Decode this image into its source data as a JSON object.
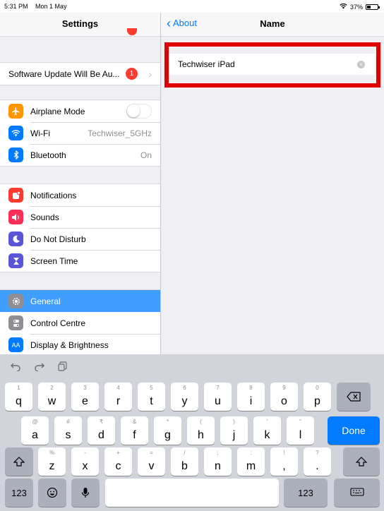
{
  "status_bar": {
    "time": "5:31 PM",
    "date": "Mon 1 May",
    "battery": "37%",
    "battery_level": 0.37
  },
  "sidebar": {
    "title": "Settings",
    "update_row": {
      "label": "Software Update Will Be Au...",
      "badge": "1"
    },
    "connectivity": [
      {
        "label": "Airplane Mode",
        "icon": "airplane-icon",
        "color": "#ff9500",
        "value": "",
        "toggle": false
      },
      {
        "label": "Wi-Fi",
        "icon": "wifi-icon",
        "color": "#007aff",
        "value": "Techwiser_5GHz"
      },
      {
        "label": "Bluetooth",
        "icon": "bluetooth-icon",
        "color": "#007aff",
        "value": "On"
      }
    ],
    "notifications": [
      {
        "label": "Notifications",
        "icon": "notifications-icon",
        "color": "#ff3b30"
      },
      {
        "label": "Sounds",
        "icon": "speaker-icon",
        "color": "#ff2d55"
      },
      {
        "label": "Do Not Disturb",
        "icon": "moon-icon",
        "color": "#5856d6"
      },
      {
        "label": "Screen Time",
        "icon": "hourglass-icon",
        "color": "#5856d6"
      }
    ],
    "general": [
      {
        "label": "General",
        "icon": "gear-icon",
        "color": "#8e8e93",
        "selected": true
      },
      {
        "label": "Control Centre",
        "icon": "switches-icon",
        "color": "#8e8e93"
      },
      {
        "label": "Display & Brightness",
        "icon": "text-size-icon",
        "color": "#007aff",
        "glyph": "AA"
      }
    ]
  },
  "detail": {
    "back_label": "About",
    "title": "Name",
    "name_value": "Techwiser iPad"
  },
  "keyboard": {
    "row1": [
      {
        "k": "q",
        "h": "1"
      },
      {
        "k": "w",
        "h": "2"
      },
      {
        "k": "e",
        "h": "3"
      },
      {
        "k": "r",
        "h": "4"
      },
      {
        "k": "t",
        "h": "5"
      },
      {
        "k": "y",
        "h": "6"
      },
      {
        "k": "u",
        "h": "7"
      },
      {
        "k": "i",
        "h": "8"
      },
      {
        "k": "o",
        "h": "9"
      },
      {
        "k": "p",
        "h": "0"
      }
    ],
    "row2": [
      {
        "k": "a",
        "h": "@"
      },
      {
        "k": "s",
        "h": "#"
      },
      {
        "k": "d",
        "h": "₹"
      },
      {
        "k": "f",
        "h": "&"
      },
      {
        "k": "g",
        "h": "*"
      },
      {
        "k": "h",
        "h": "("
      },
      {
        "k": "j",
        "h": ")"
      },
      {
        "k": "k",
        "h": "'"
      },
      {
        "k": "l",
        "h": "\""
      }
    ],
    "row3": [
      {
        "k": "z",
        "h": "%"
      },
      {
        "k": "x",
        "h": "-"
      },
      {
        "k": "c",
        "h": "+"
      },
      {
        "k": "v",
        "h": "="
      },
      {
        "k": "b",
        "h": "/"
      },
      {
        "k": "n",
        "h": ";"
      },
      {
        "k": "m",
        "h": ":"
      },
      {
        "k": ",",
        "h": "!"
      },
      {
        "k": ".",
        "h": "?"
      }
    ],
    "done_label": "Done",
    "numbers_label": "123"
  }
}
